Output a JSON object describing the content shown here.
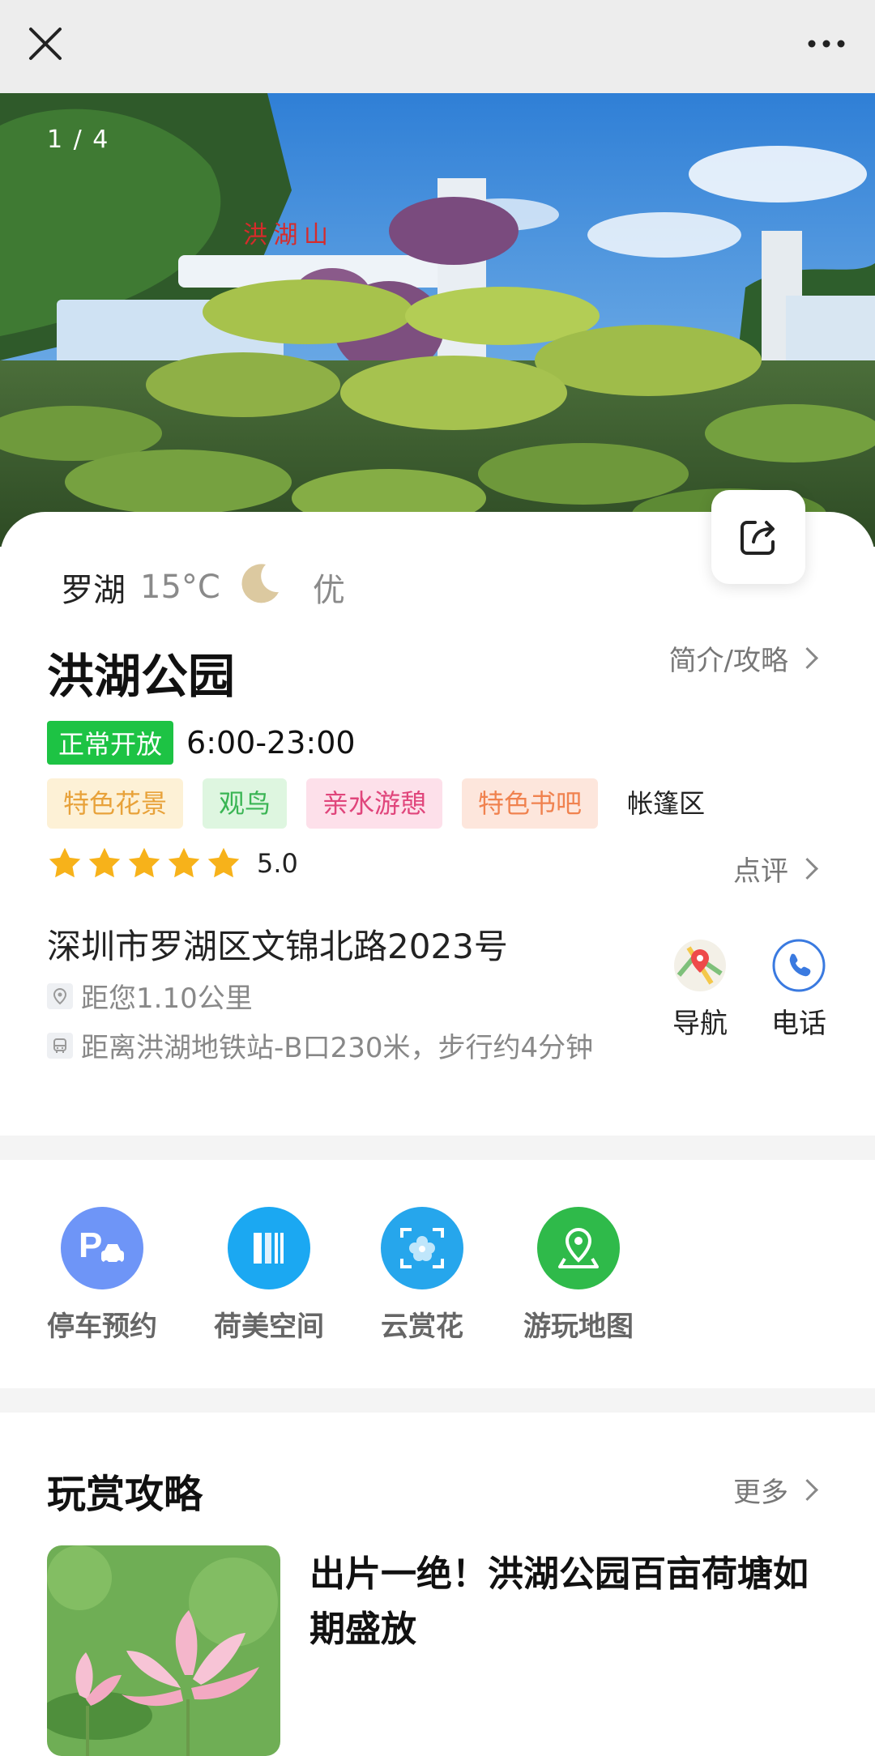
{
  "topbar": {
    "close_icon": "close-icon",
    "more_icon": "more-dots-icon"
  },
  "hero": {
    "counter": "1 / 4"
  },
  "weather": {
    "city": "罗湖",
    "temp": "15°C",
    "air_quality": "优"
  },
  "park": {
    "name": "洪湖公园",
    "intro_link": "简介/攻略",
    "status": "正常开放",
    "hours": "6:00-23:00",
    "tags": [
      {
        "label": "特色花景",
        "bg": "#fdf1d6",
        "color": "#e8a23a"
      },
      {
        "label": "观鸟",
        "bg": "#def6e0",
        "color": "#3ab554"
      },
      {
        "label": "亲水游憩",
        "bg": "#fde0ea",
        "color": "#e0457b"
      },
      {
        "label": "特色书吧",
        "bg": "#fde6dc",
        "color": "#f0824f"
      },
      {
        "label": "帐篷区",
        "bg": "",
        "color": "#222222"
      }
    ],
    "rating": 5,
    "rating_text": "5.0",
    "review_link": "点评",
    "address": "深圳市罗湖区文锦北路2023号",
    "distance": "距您1.10公里",
    "transit": "距离洪湖地铁站-B口230米，步行约4分钟",
    "nav_label": "导航",
    "phone_label": "电话"
  },
  "quick_links": [
    {
      "label": "停车预约",
      "color": "#6e95f7"
    },
    {
      "label": "荷美空间",
      "color": "#1ba8f2"
    },
    {
      "label": "云赏花",
      "color": "#26a6ec"
    },
    {
      "label": "游玩地图",
      "color": "#2fba4a"
    }
  ],
  "guide": {
    "title": "玩赏攻略",
    "more_link": "更多",
    "article_title": "出片一绝！洪湖公园百亩荷塘如期盛放"
  },
  "colors": {
    "open_green": "#1dc344",
    "star": "#f7b21a"
  }
}
